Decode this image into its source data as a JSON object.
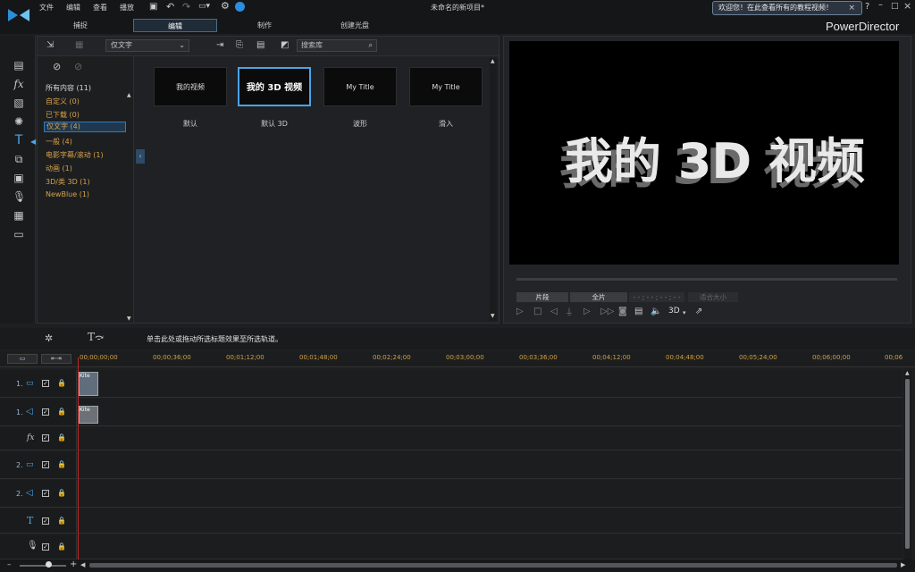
{
  "menu": [
    "文件",
    "编辑",
    "查看",
    "播放"
  ],
  "project_title": "未命名的新项目*",
  "tabs": [
    "捕捉",
    "编辑",
    "制作",
    "创建光盘"
  ],
  "welcome": "欢迎您！在此查看所有的教程视频！",
  "brand": "PowerDirector",
  "library": {
    "filter": "仅文字",
    "search_placeholder": "搜索库",
    "categories": [
      "所有内容 (11)",
      "自定义 (0)",
      "已下载 (0)",
      "仅文字 (4)",
      "一般 (4)",
      "电影字幕/滚动 (1)",
      "动画 (1)",
      "3D/类 3D (1)",
      "NewBlue (1)"
    ],
    "thumbs": [
      {
        "text": "我的视频",
        "label": "默认"
      },
      {
        "text": "我的 3D 视频",
        "label": "默认 3D"
      },
      {
        "text": "My Title",
        "label": "波形"
      },
      {
        "text": "My Title",
        "label": "滑入"
      }
    ]
  },
  "preview": {
    "screen_text": "我的 3D 视频",
    "clip_tab": "片段",
    "movie_tab": "全片",
    "timecode": "- - ; - - ; - - ; - -",
    "fit": "适合大小",
    "mode_3d": "3D"
  },
  "timeline": {
    "hint": "单击此处或拖动所选标题效果至所选轨道。",
    "ticks": [
      "00;00;00;00",
      "00;00;36;00",
      "00;01;12;00",
      "00;01;48;00",
      "00;02;24;00",
      "00;03;00;00",
      "00;03;36;00",
      "00;04;12;00",
      "00;04;48;00",
      "00;05;24;00",
      "00;06;00;00",
      "00;06"
    ],
    "tracks": [
      "1.",
      "1.",
      "",
      "2.",
      "2.",
      "",
      ""
    ],
    "clip_label": "Kite"
  }
}
